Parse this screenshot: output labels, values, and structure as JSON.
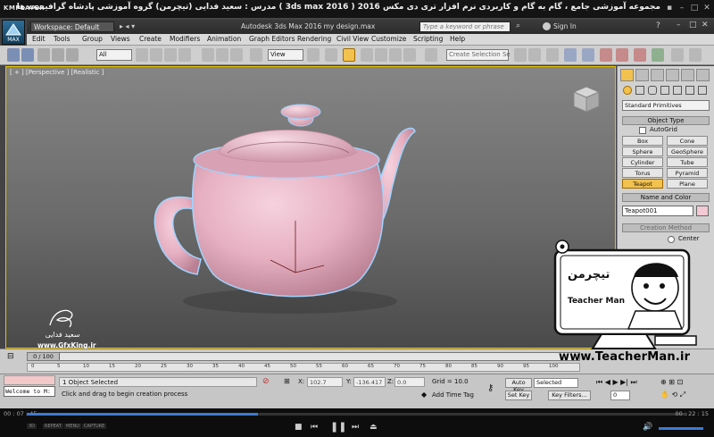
{
  "player": {
    "logo": "KMPLAYER",
    "title": "مجموعه آموزشی جامع ، گام به گام و کاربردی نرم افزار تری دی مکس 2016 ( 3ds max 2016 ) مدرس : سعید فدایی (تیچرمن) گروه آموزشی پادشاه گرافیست ها",
    "time_elapsed": "00 : 07 : 45",
    "time_total": "00 : 22 : 15",
    "progress": 0.35,
    "bottom_labels": [
      "3D",
      "REPEAT",
      "MENU",
      "CAPTURE"
    ]
  },
  "max": {
    "app_button": "MAX",
    "workspace": "Workspace: Default",
    "title": "Autodesk 3ds Max 2016     my design.max",
    "search_placeholder": "Type a keyword or phrase",
    "signin": "Sign In",
    "menu": [
      "Edit",
      "Tools",
      "Group",
      "Views",
      "Create",
      "Modifiers",
      "Animation",
      "Graph Editors",
      "Rendering",
      "Civil View",
      "Customize",
      "Scripting",
      "Help"
    ],
    "toolbar": {
      "selection_filter": "All",
      "ref_coord": "View",
      "selection_set": "Create Selection Se"
    },
    "viewport_label": "[ + ] [Perspective ] [Realistic ]",
    "command_panel": {
      "dropdown": "Standard Primitives",
      "object_type_title": "Object Type",
      "autogrid_label": "AutoGrid",
      "buttons": [
        "Box",
        "Cone",
        "Sphere",
        "GeoSphere",
        "Cylinder",
        "Tube",
        "Torus",
        "Pyramid",
        "Teapot",
        "Plane"
      ],
      "active_button": "Teapot",
      "name_color_title": "Name and Color",
      "object_name": "Teapot001",
      "object_color": "#f2c9d4",
      "creation_method_title": "Creation Method",
      "creation_option": "Center"
    },
    "timeline": {
      "slider_label": "0 / 100",
      "ticks": [
        "0",
        "5",
        "10",
        "15",
        "20",
        "25",
        "30",
        "35",
        "40",
        "45",
        "50",
        "55",
        "60",
        "65",
        "70",
        "75",
        "80",
        "85",
        "90",
        "95",
        "100"
      ]
    },
    "status": {
      "maxscript_text": "Welcome to M:",
      "selected": "1 Object Selected",
      "prompt": "Click and drag to begin creation process",
      "x_label": "X:",
      "x_value": "102.7",
      "y_label": "Y:",
      "y_value": "-136.417",
      "z_label": "Z:",
      "z_value": "0.0",
      "grid": "Grid = 10.0",
      "add_time_tag": "Add Time Tag",
      "auto_key": "Auto Key",
      "set_key": "Set Key",
      "key_mode": "Selected",
      "key_filters": "Key Filters...",
      "frame": "0"
    }
  },
  "watermark": {
    "name": "سعید فدایی",
    "site": "www.GfxKing.ir",
    "logo_text": "تیچرمن",
    "logo_sub": "Teacher Man",
    "url": "www.TeacherMan.ir"
  },
  "colors": {
    "teapot": "#e8b6c8",
    "viewport_border": "#e8c200",
    "active_button": "#f2c14e"
  }
}
